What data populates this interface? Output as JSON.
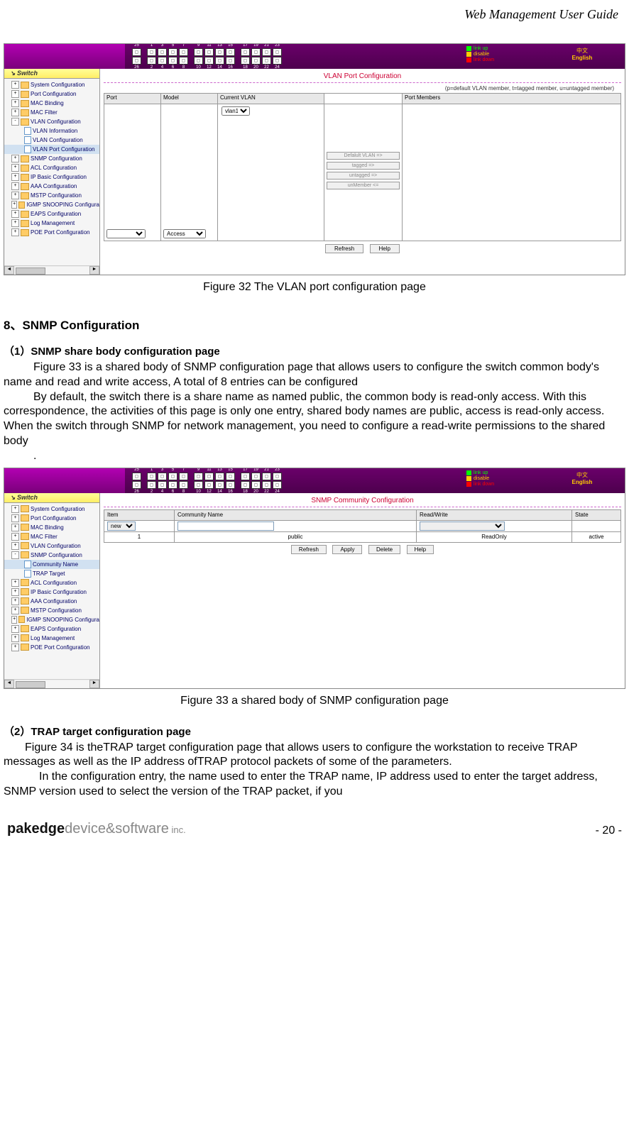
{
  "header": "Web Management User Guide",
  "fig32": {
    "caption": "Figure 32 The VLAN port configuration page",
    "title": "VLAN Port Configuration",
    "hint": "(p=default VLAN member, t=tagged member, u=untagged member)",
    "cols": {
      "port": "Port",
      "model": "Model",
      "cvlan": "Current VLAN",
      "members": "Port Members"
    },
    "model_sel": "Access",
    "cvlan_sel": "vlan1",
    "btns": {
      "b1": "Defalult  VLAN =>",
      "b2": "tagged =>",
      "b3": "untagged =>",
      "b4": "unMember <="
    },
    "footer": {
      "refresh": "Refresh",
      "help": "Help"
    }
  },
  "sidebar": {
    "title": "Switch",
    "items_a": [
      "System Configuration",
      "Port Configuration",
      "MAC Binding",
      "MAC Filter"
    ],
    "vlan": {
      "top": "VLAN Configuration",
      "sub": [
        "VLAN Information",
        "VLAN Configuration",
        "VLAN Port Configuration"
      ]
    },
    "snmp": {
      "top": "SNMP Configuration",
      "sub": [
        "Community Name",
        "TRAP Target"
      ]
    },
    "items_b_post_vlan": [
      "SNMP Configuration",
      "ACL Configuration",
      "IP Basic Configuration",
      "AAA Configuration",
      "MSTP Configuration",
      "IGMP SNOOPING Configura",
      "EAPS Configuration",
      "Log Management",
      "POE Port Configuration"
    ],
    "items_b_post_snmp": [
      "ACL Configuration",
      "IP Basic Configuration",
      "AAA Configuration",
      "MSTP Configuration",
      "IGMP SNOOPING Configura",
      "EAPS Configuration",
      "Log Management",
      "POE Port Configuration"
    ]
  },
  "portnums_top": [
    "25",
    "1",
    "3",
    "5",
    "7",
    "9",
    "11",
    "13",
    "15",
    "17",
    "19",
    "21",
    "23"
  ],
  "portnums_bot": [
    "26",
    "2",
    "4",
    "6",
    "8",
    "10",
    "12",
    "14",
    "16",
    "18",
    "20",
    "22",
    "24"
  ],
  "legend": {
    "up": "link up",
    "dis": "disable",
    "down": "link down"
  },
  "lang": {
    "zh": "中文",
    "en": "English"
  },
  "section8": {
    "h": "8、SNMP Configuration",
    "sub1_h": "（1）SNMP share body configuration page",
    "sub1_p1": "Figure 33 is a shared body of SNMP configuration page that allows users to configure the switch common body's name and read and write access, A total of 8 entries can be configured",
    "sub1_p2": "By default, the switch there is a share name as named public, the common body is read-only access. With this correspondence, the activities of this page is only one entry, shared body names are public, access is read-only access. When the switch through SNMP for network management, you need to configure a read-write permissions to the shared body",
    "sub1_dot": ".",
    "sub2_h": "（2）TRAP target configuration page",
    "sub2_p1": "Figure 34 is theTRAP target configuration page that allows users to configure the workstation to receive TRAP messages as well as the IP address ofTRAP protocol packets of some of the parameters.",
    "sub2_p2": "In the configuration entry, the name used to enter the TRAP name, IP address used to enter the target address, SNMP version used to select the version of the TRAP packet, if you"
  },
  "fig33": {
    "caption": "Figure 33 a shared body of SNMP configuration page",
    "title": "SNMP Community Configuration",
    "cols": {
      "item": "Item",
      "cname": "Community Name",
      "rw": "Read/Write",
      "state": "State"
    },
    "item_sel": "new",
    "row": {
      "num": "1",
      "name": "public",
      "rw": "ReadOnly",
      "state": "active"
    },
    "btns": {
      "refresh": "Refresh",
      "apply": "Apply",
      "delete": "Delete",
      "help": "Help"
    }
  },
  "footer": {
    "logo_b": "pakedge",
    "logo_g": "device&software",
    "logo_inc": " inc.",
    "page": "- 20 -"
  }
}
